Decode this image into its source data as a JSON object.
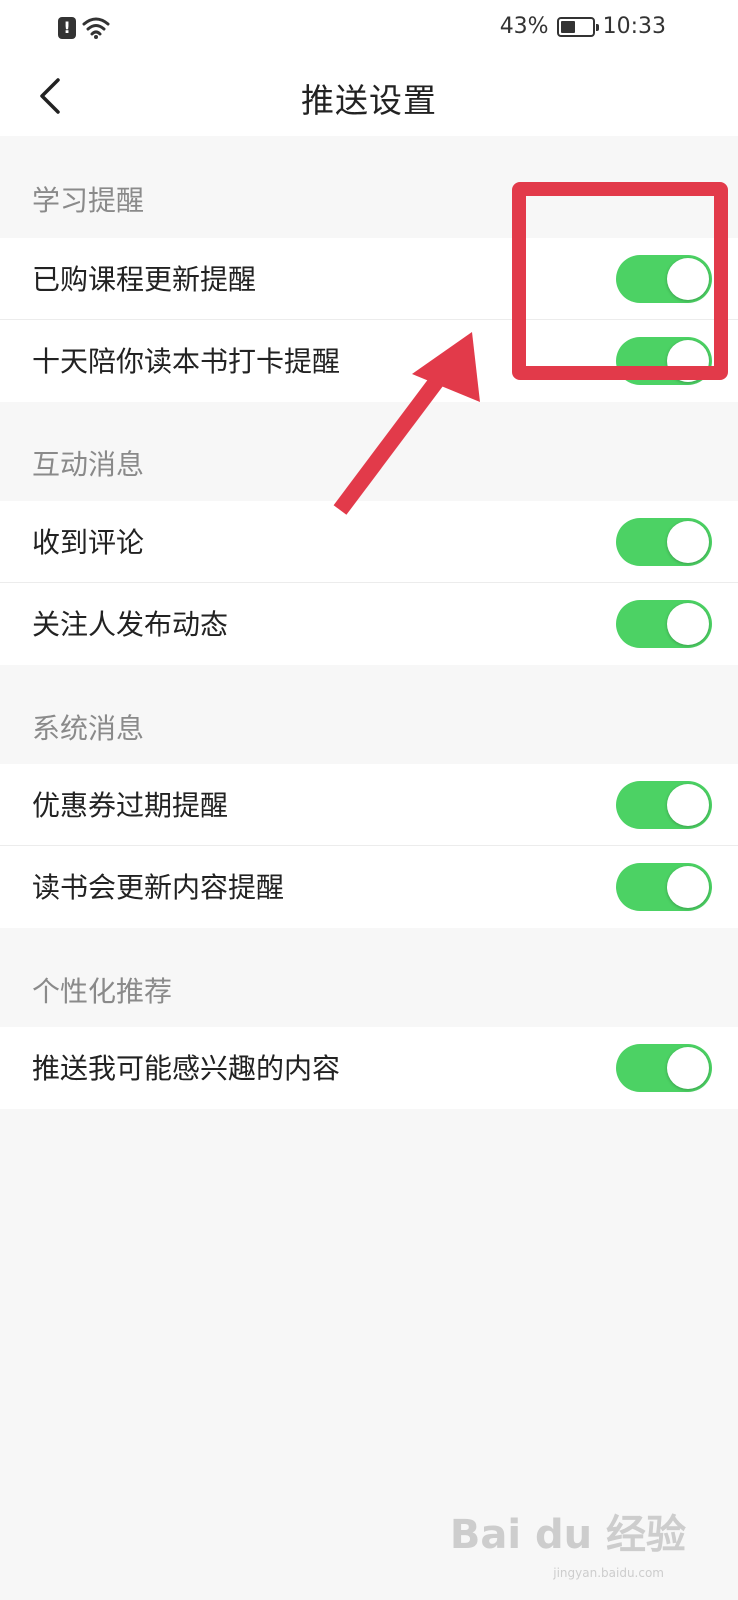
{
  "status_bar": {
    "alert_glyph": "!",
    "battery_percent": "43%",
    "battery_level": 0.43,
    "time": "10:33",
    "icons": [
      "alert-icon",
      "wifi-icon",
      "battery-icon"
    ]
  },
  "nav": {
    "back_icon": "chevron-left-icon",
    "title": "推送设置"
  },
  "sections": [
    {
      "header": "学习提醒",
      "items": [
        {
          "label": "已购课程更新提醒",
          "enabled": true
        },
        {
          "label": "十天陪你读本书打卡提醒",
          "enabled": true
        }
      ]
    },
    {
      "header": "互动消息",
      "items": [
        {
          "label": "收到评论",
          "enabled": true
        },
        {
          "label": "关注人发布动态",
          "enabled": true
        }
      ]
    },
    {
      "header": "系统消息",
      "items": [
        {
          "label": "优惠券过期提醒",
          "enabled": true
        },
        {
          "label": "读书会更新内容提醒",
          "enabled": true
        }
      ]
    },
    {
      "header": "个性化推荐",
      "items": [
        {
          "label": "推送我可能感兴趣的内容",
          "enabled": true
        }
      ]
    }
  ],
  "colors": {
    "toggle_on": "#4cd264",
    "annotation": "#e23a4a",
    "background": "#f7f7f7"
  },
  "watermark": {
    "logo_text": "Bai du 经验",
    "sub": "jingyan.baidu.com"
  }
}
